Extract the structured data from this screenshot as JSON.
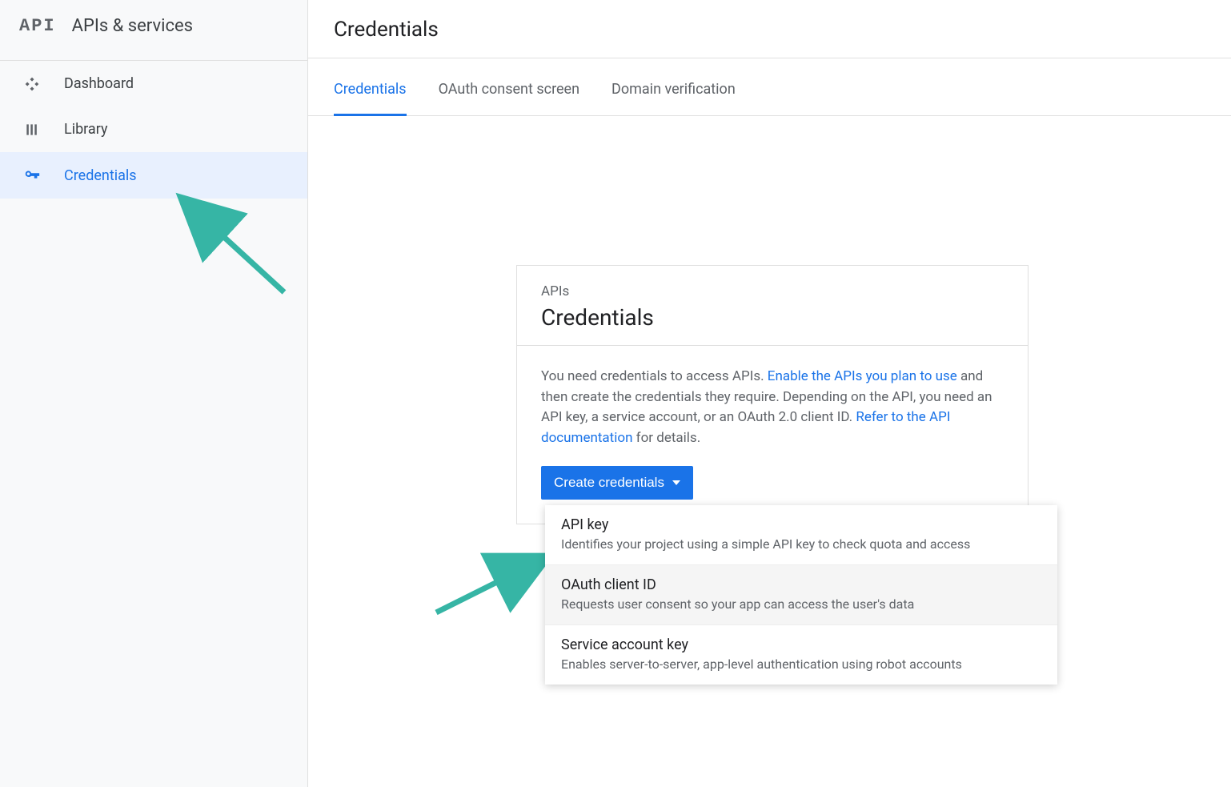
{
  "sidebar": {
    "logo_text": "API",
    "title": "APIs & services",
    "items": [
      {
        "label": "Dashboard",
        "icon": "diamond"
      },
      {
        "label": "Library",
        "icon": "library"
      },
      {
        "label": "Credentials",
        "icon": "key"
      }
    ]
  },
  "header": {
    "title": "Credentials"
  },
  "tabs": [
    {
      "label": "Credentials",
      "active": true
    },
    {
      "label": "OAuth consent screen",
      "active": false
    },
    {
      "label": "Domain verification",
      "active": false
    }
  ],
  "card": {
    "eyebrow": "APIs",
    "title": "Credentials",
    "text_before_link1": "You need credentials to access APIs. ",
    "link1": "Enable the APIs you plan to use",
    "text_mid": " and then create the credentials they require. Depending on the API, you need an API key, a service account, or an OAuth 2.0 client ID. ",
    "link2": "Refer to the API documentation",
    "text_after": " for details.",
    "button": "Create credentials"
  },
  "dropdown": [
    {
      "title": "API key",
      "desc": "Identifies your project using a simple API key to check quota and access"
    },
    {
      "title": "OAuth client ID",
      "desc": "Requests user consent so your app can access the user's data"
    },
    {
      "title": "Service account key",
      "desc": "Enables server-to-server, app-level authentication using robot accounts"
    }
  ],
  "colors": {
    "accent": "#1a73e8",
    "arrow": "#36b5a5"
  }
}
